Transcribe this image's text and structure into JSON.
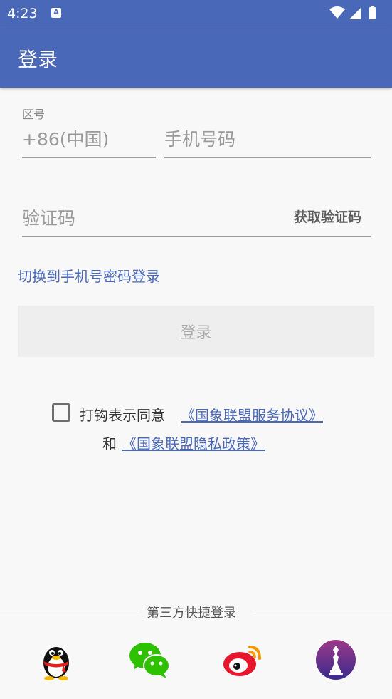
{
  "status_bar": {
    "time": "4:23",
    "notification_letter": "A"
  },
  "app_bar": {
    "title": "登录"
  },
  "form": {
    "area_code_label": "区号",
    "area_code_value": "+86(中国)",
    "phone_placeholder": "手机号码",
    "code_placeholder": "验证码",
    "get_code_label": "获取验证码"
  },
  "switch_link": "切换到手机号密码登录",
  "login_button": "登录",
  "agreement": {
    "prefix": "打钩表示同意",
    "service_link": "《国象联盟服务协议》",
    "and": "和",
    "privacy_link": "《国象联盟隐私政策》",
    "checked": false
  },
  "third_party": {
    "label": "第三方快捷登录",
    "icons": [
      "qq-icon",
      "wechat-icon",
      "weibo-icon",
      "chess-app-icon"
    ]
  },
  "colors": {
    "primary": "#4a68b8",
    "button_bg": "#eeeeee"
  }
}
